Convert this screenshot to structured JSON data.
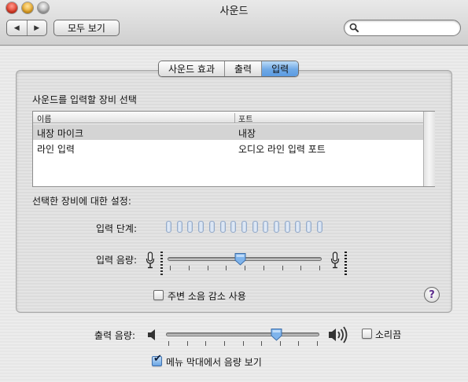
{
  "window": {
    "title": "사운드"
  },
  "toolbar": {
    "back_icon": "triangle-left-icon",
    "forward_icon": "triangle-right-icon",
    "show_all_label": "모두 보기",
    "search_placeholder": "",
    "search_value": ""
  },
  "tabs": [
    {
      "label": "사운드 효과",
      "selected": false
    },
    {
      "label": "출력",
      "selected": false
    },
    {
      "label": "입력",
      "selected": true
    }
  ],
  "input_pane": {
    "device_section_title": "사운드를 입력할 장비 선택",
    "table": {
      "columns": [
        "이름",
        "포트"
      ],
      "rows": [
        {
          "name": "내장 마이크",
          "port": "내장",
          "selected": true
        },
        {
          "name": "라인 입력",
          "port": "오디오 라인 입력 포트",
          "selected": false
        }
      ]
    },
    "settings_title": "선택한 장비에 대한 설정:",
    "input_level_label": "입력 단계:",
    "input_level_segments": 15,
    "input_level_lit": 0,
    "input_volume_label": "입력 음량:",
    "input_volume_fraction": 0.47,
    "noise_reduction": {
      "label": "주변 소음 감소 사용",
      "checked": false
    },
    "help_label": "?"
  },
  "output": {
    "volume_label": "출력 음량:",
    "volume_fraction": 0.72,
    "mute": {
      "label": "소리끔",
      "checked": false
    },
    "show_in_menubar": {
      "label": "메뉴 막대에서 음량 보기",
      "checked": true
    }
  },
  "colors": {
    "selected_tab": "#6fa9e6",
    "level_segment": "#c1d2e8",
    "help_glyph": "#5b2a8c"
  }
}
